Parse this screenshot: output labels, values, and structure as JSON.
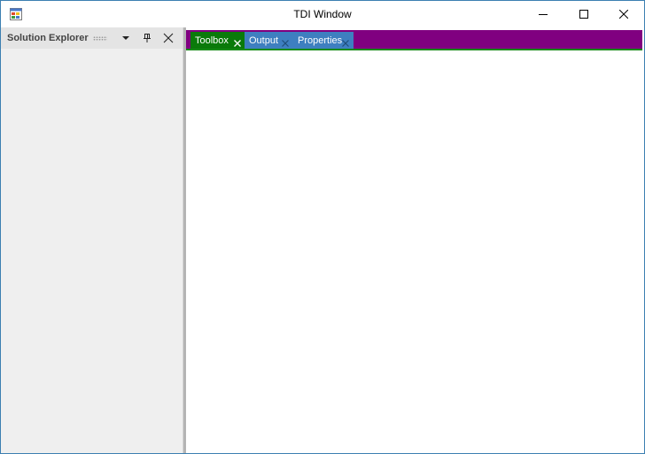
{
  "window": {
    "title": "TDI Window",
    "icon": "app-window-icon",
    "controls": [
      "minimize-icon",
      "maximize-icon",
      "close-icon"
    ]
  },
  "dock_panel": {
    "title": "Solution Explorer",
    "buttons": [
      "dropdown-arrow-icon",
      "pin-icon",
      "close-icon"
    ]
  },
  "tabs": [
    {
      "label": "Toolbox",
      "active": true
    },
    {
      "label": "Output",
      "active": false
    },
    {
      "label": "Properties",
      "active": false
    }
  ],
  "colors": {
    "tabstrip_bg": "#800080",
    "active_tab": "#0a7a0a",
    "inactive_tab": "#3e7fc0",
    "tab_underline": "#178a17",
    "window_border": "#3c7fb1"
  }
}
